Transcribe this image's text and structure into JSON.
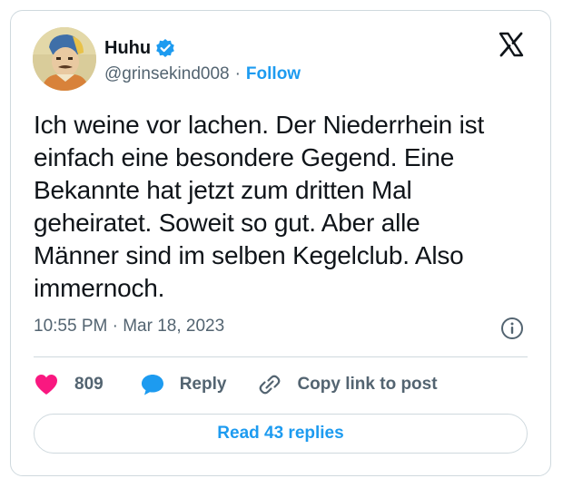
{
  "author": {
    "display_name": "Huhu",
    "handle": "@grinsekind008",
    "separator": "·",
    "follow_label": "Follow",
    "verified_color": "#1d9bf0"
  },
  "tweet": {
    "text": "Ich weine vor lachen. Der Niederrhein ist\neinfach eine besondere Gegend. Eine\nBekannte hat jetzt zum dritten Mal\ngeheiratet. Soweit so gut. Aber alle\nMänner sind im selben Kegelclub. Also\nimmernoch.",
    "timestamp": "10:55 PM · Mar 18, 2023"
  },
  "actions": {
    "like_count": "809",
    "reply_label": "Reply",
    "copy_link_label": "Copy link to post"
  },
  "footer": {
    "read_replies_label": "Read 43 replies"
  },
  "icons": {
    "platform_logo": "x-logo-icon",
    "verified": "verified-badge-icon",
    "info": "info-icon",
    "like": "heart-icon",
    "reply": "speech-bubble-icon",
    "copy": "link-icon"
  },
  "colors": {
    "accent": "#1d9bf0",
    "like": "#f91880",
    "text": "#0f1419",
    "muted": "#536471",
    "border": "#cfd9de"
  }
}
